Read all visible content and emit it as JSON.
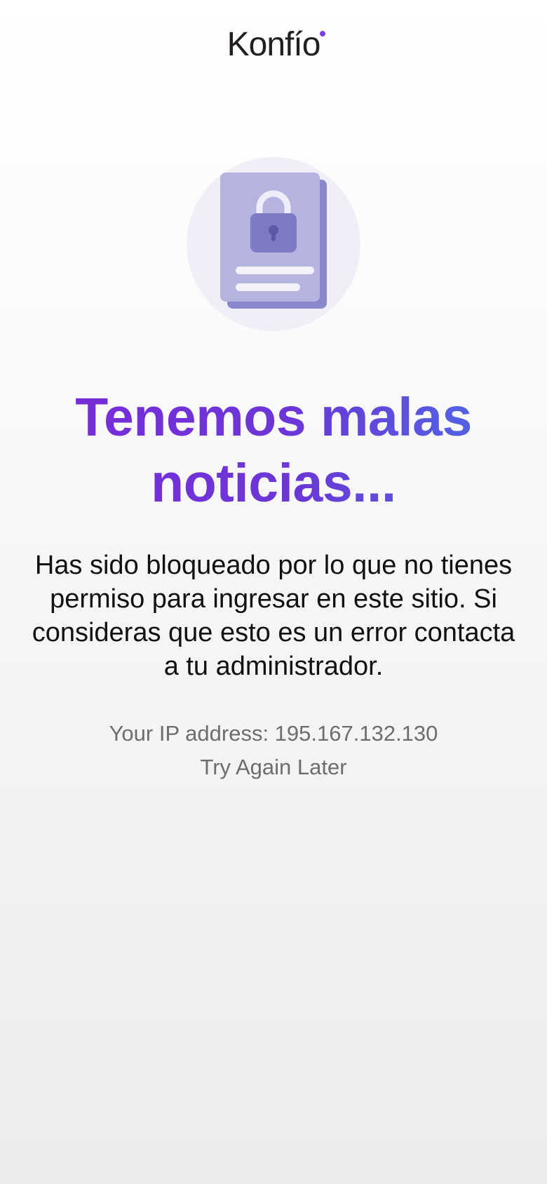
{
  "header": {
    "logo_text": "Konfío",
    "logo_dot_color": "#7a3ee0"
  },
  "illustration": {
    "icon": "locked-document-icon"
  },
  "main": {
    "title": "Tenemos malas noticias...",
    "message": "Has sido bloqueado por lo que no tienes permiso para ingresar en este sitio. Si consideras que esto es un error contacta a tu administrador.",
    "ip_label": "Your IP address: 195.167.132.130",
    "retry_text": "Try Again Later"
  },
  "colors": {
    "title_gradient_start": "#7a2bd9",
    "title_gradient_end": "#4d6ae3",
    "message_text": "#111111",
    "meta_text": "#6d6d6d"
  }
}
